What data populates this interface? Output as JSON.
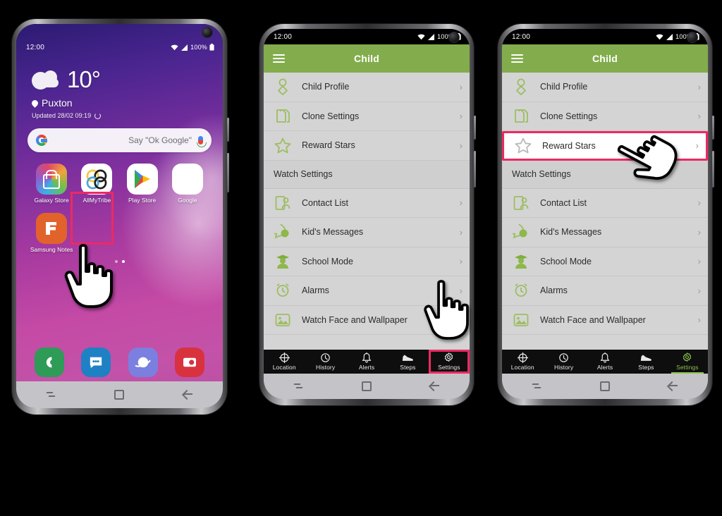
{
  "phones": [
    {
      "id": "phone-home",
      "status": {
        "time": "12:00",
        "battery": "100%",
        "icons": [
          "wifi-icon",
          "signal-icon",
          "battery-icon"
        ]
      },
      "home": {
        "weather": {
          "temperature": "10°",
          "location": "Puxton",
          "updated": "Updated 28/02 09:19",
          "condition_icon": "cloud-icon"
        },
        "search": {
          "placeholder": "Say \"Ok Google\"",
          "logo": "google-logo",
          "mic": "microphone-icon"
        },
        "apps": [
          {
            "label": "Galaxy Store",
            "icon": "galaxy-store-icon"
          },
          {
            "label": "AllMyTribe",
            "icon": "allmytribe-icon",
            "highlighted": true
          },
          {
            "label": "Play Store",
            "icon": "play-store-icon"
          },
          {
            "label": "Google",
            "icon": "google-folder-icon"
          },
          {
            "label": "Samsung Notes",
            "icon": "samsung-notes-icon"
          }
        ],
        "dock": [
          {
            "label": "Phone",
            "icon": "phone-icon"
          },
          {
            "label": "Messages",
            "icon": "messages-icon"
          },
          {
            "label": "Internet",
            "icon": "internet-icon"
          },
          {
            "label": "Camera",
            "icon": "camera-icon"
          }
        ],
        "page_dots": 2,
        "active_dot": 1
      },
      "navbar": [
        "recents-icon",
        "home-icon",
        "back-icon"
      ]
    },
    {
      "id": "phone-settings-list",
      "status": {
        "time": "12:00",
        "battery": "100%"
      },
      "appbar": {
        "title": "Child",
        "menu_icon": "hamburger-icon"
      },
      "list": [
        {
          "type": "row",
          "label": "Child Profile",
          "icon": "person-icon"
        },
        {
          "type": "row",
          "label": "Clone Settings",
          "icon": "clone-icon"
        },
        {
          "type": "row",
          "label": "Reward Stars",
          "icon": "star-icon"
        },
        {
          "type": "section",
          "label": "Watch Settings"
        },
        {
          "type": "row",
          "label": "Contact List",
          "icon": "contacts-icon"
        },
        {
          "type": "row",
          "label": "Kid's Messages",
          "icon": "chat-icon"
        },
        {
          "type": "row",
          "label": "School Mode",
          "icon": "student-icon"
        },
        {
          "type": "row",
          "label": "Alarms",
          "icon": "clock-icon"
        },
        {
          "type": "row",
          "label": "Watch Face and Wallpaper",
          "icon": "wallpaper-icon"
        }
      ],
      "tabs": [
        {
          "label": "Location",
          "icon": "crosshair-icon",
          "active": false
        },
        {
          "label": "History",
          "icon": "clock-icon",
          "active": false
        },
        {
          "label": "Alerts",
          "icon": "bell-icon",
          "active": false
        },
        {
          "label": "Steps",
          "icon": "shoe-icon",
          "active": false
        },
        {
          "label": "Settings",
          "icon": "gear-icon",
          "active": false,
          "highlighted": true
        }
      ],
      "navbar": [
        "recents-icon",
        "home-icon",
        "back-icon"
      ]
    },
    {
      "id": "phone-settings-list-reward",
      "status": {
        "time": "12:00",
        "battery": "100%"
      },
      "appbar": {
        "title": "Child",
        "menu_icon": "hamburger-icon"
      },
      "list": [
        {
          "type": "row",
          "label": "Child Profile",
          "icon": "person-icon"
        },
        {
          "type": "row",
          "label": "Clone Settings",
          "icon": "clone-icon"
        },
        {
          "type": "row",
          "label": "Reward Stars",
          "icon": "star-icon",
          "highlighted": true
        },
        {
          "type": "section",
          "label": "Watch Settings"
        },
        {
          "type": "row",
          "label": "Contact List",
          "icon": "contacts-icon"
        },
        {
          "type": "row",
          "label": "Kid's Messages",
          "icon": "chat-icon"
        },
        {
          "type": "row",
          "label": "School Mode",
          "icon": "student-icon"
        },
        {
          "type": "row",
          "label": "Alarms",
          "icon": "clock-icon"
        },
        {
          "type": "row",
          "label": "Watch Face and Wallpaper",
          "icon": "wallpaper-icon"
        }
      ],
      "tabs": [
        {
          "label": "Location",
          "icon": "crosshair-icon",
          "active": false
        },
        {
          "label": "History",
          "icon": "clock-icon",
          "active": false
        },
        {
          "label": "Alerts",
          "icon": "bell-icon",
          "active": false
        },
        {
          "label": "Steps",
          "icon": "shoe-icon",
          "active": false
        },
        {
          "label": "Settings",
          "icon": "gear-icon",
          "active": true
        }
      ],
      "navbar": [
        "recents-icon",
        "home-icon",
        "back-icon"
      ]
    }
  ],
  "colors": {
    "accent_green": "#83ad4c",
    "highlight_pink": "#ec2a62",
    "tabbar_bg": "#0e0e0e",
    "list_bg": "#d4d4d4"
  },
  "chevron": "›"
}
